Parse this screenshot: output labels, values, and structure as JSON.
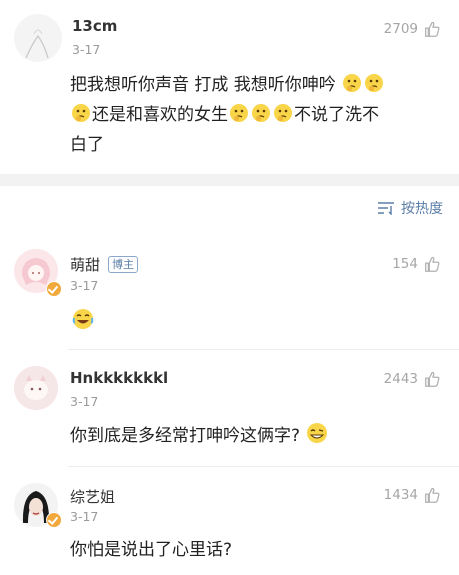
{
  "post": {
    "user": "13cm",
    "date": "3-17",
    "likes": "2709",
    "text_line1": "把我想听你声音 打成 我想听你呻吟",
    "text_line2": "还是和喜欢的女生",
    "text_line2_after": "不说了洗不",
    "text_line3": "白了"
  },
  "sort": {
    "label": "按热度"
  },
  "comments": [
    {
      "user": "萌甜",
      "tag": "博主",
      "date": "3-17",
      "likes": "154",
      "text": ""
    },
    {
      "user": "Hnkkkkkkkl",
      "date": "3-17",
      "likes": "2443",
      "text": "你到底是多经常打呻吟这俩字?"
    },
    {
      "user": "综艺姐",
      "date": "3-17",
      "likes": "1434",
      "text": "你怕是说出了心里话?"
    }
  ],
  "colors": {
    "link": "#5b7ea8",
    "meta": "#9a9a9a",
    "badge": "#f2a93b"
  }
}
